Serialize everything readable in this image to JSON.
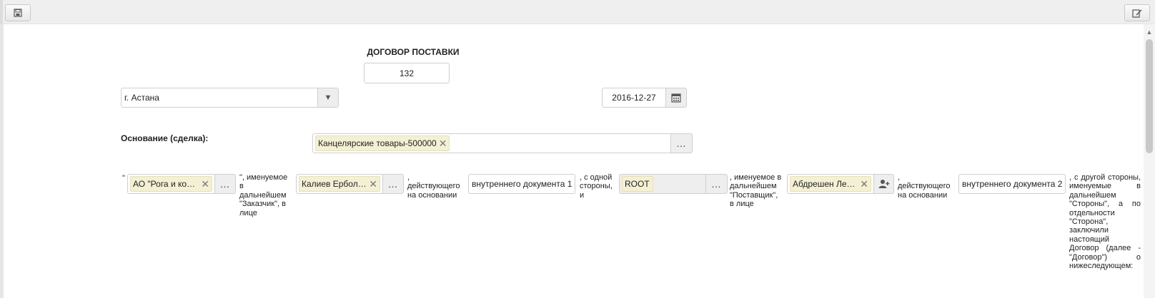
{
  "toolbar": {
    "save_icon": "floppy-disk-icon",
    "edit_icon": "edit-note-icon"
  },
  "document": {
    "title": "ДОГОВОР ПОСТАВКИ",
    "number": "132",
    "city": "г. Астана",
    "date": "2016-12-27",
    "basis_label": "Основание (сделка):",
    "basis_tag": "Канцелярские товары-500000"
  },
  "parties": {
    "quote_open": "\"",
    "customer_tag": "АО \"Рога и коп…",
    "text_customer": "\", именуемое в дальнейшем \"Заказчик\", в лице",
    "customer_rep_tag": "Калиев Ербол …",
    "text_acting1": ", действующего на основании",
    "doc1": "внутреннего документа 1",
    "text_one_side": ", с одной стороны, и",
    "supplier_tag": "ROOT",
    "text_supplier": ", именуемое в дальнейшем \"Поставщик\", в лице",
    "supplier_rep_tag": "Абдрешен Лео…",
    "text_acting2": ", действующего на основании",
    "doc2": "внутреннего документа 2",
    "text_other_side": ", с другой стороны, именуемые в дальнейшем \"Стороны\", а по отдельности \"Сторона\", заключили настоящий Договор (далее - \"Договор\") о нижеследующем:"
  },
  "colors": {
    "tag_bg": "#f4f0d4",
    "toolbar_bg": "#efefef",
    "button_bg": "#eeeeee"
  }
}
